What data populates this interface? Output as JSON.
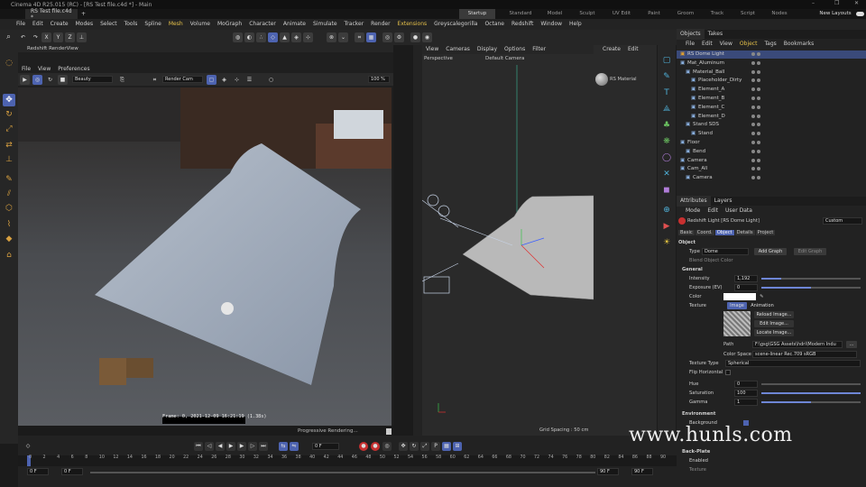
{
  "window": {
    "title": "Cinema 4D R25.015 (RC) - [RS Test file.c4d *] - Main",
    "min": "–",
    "max": "❐",
    "close": "✕"
  },
  "tabs": {
    "doc": "RS Test file.c4d *",
    "add": "+",
    "layouts": [
      "Startup (User)",
      "Standard",
      "Model",
      "Sculpt",
      "UV Edit",
      "Paint",
      "Groom",
      "Track",
      "Script",
      "Nodes"
    ],
    "new_layouts": "New Layouts"
  },
  "menu": [
    "File",
    "Edit",
    "Create",
    "Modes",
    "Select",
    "Tools",
    "Spline",
    "Mesh",
    "Volume",
    "MoGraph",
    "Character",
    "Animate",
    "Simulate",
    "Tracker",
    "Render",
    "Extensions",
    "Greyscalegorilla",
    "Octane",
    "Redshift",
    "Window",
    "Help"
  ],
  "toolbar": {
    "axis": [
      "X",
      "Y",
      "Z"
    ],
    "coord": "⊥"
  },
  "renderview": {
    "title": "Redshift RenderView",
    "menu": [
      "File",
      "View",
      "Preferences"
    ],
    "aov": "Beauty",
    "camera": "Render Cam",
    "zoom": "100 %",
    "stamp": "Frame: 0, 2021-12-09 16:21:19 (1.38s)",
    "status": "Progressive Rendering..."
  },
  "viewport": {
    "menu": [
      "View",
      "Cameras",
      "Display",
      "Options",
      "Filter"
    ],
    "name": "Perspective",
    "camera": "Default Camera",
    "grid": "Grid Spacing : 50 cm"
  },
  "material": {
    "menu": [
      "Create",
      "Edit"
    ],
    "name": "RS Material"
  },
  "objects": {
    "tabs": [
      "Objects",
      "Takes"
    ],
    "menu": [
      "File",
      "Edit",
      "View",
      "Object",
      "Tags",
      "Bookmarks"
    ],
    "rows": [
      {
        "name": "RS Dome Light",
        "indent": 0,
        "sel": true
      },
      {
        "name": "Mat_Aluminum",
        "indent": 0
      },
      {
        "name": "Material_Ball",
        "indent": 1
      },
      {
        "name": "Placeholder_Dirty",
        "indent": 2
      },
      {
        "name": "Element_A",
        "indent": 2
      },
      {
        "name": "Element_B",
        "indent": 2
      },
      {
        "name": "Element_C",
        "indent": 2
      },
      {
        "name": "Element_D",
        "indent": 2
      },
      {
        "name": "Stand SDS",
        "indent": 1
      },
      {
        "name": "Stand",
        "indent": 2
      },
      {
        "name": "Floor",
        "indent": 0
      },
      {
        "name": "Bend",
        "indent": 1
      },
      {
        "name": "Camera",
        "indent": 0
      },
      {
        "name": "Cam_All",
        "indent": 0
      },
      {
        "name": "Camera",
        "indent": 1
      }
    ]
  },
  "attributes": {
    "tabs": [
      "Attributes",
      "Layers"
    ],
    "menu": [
      "Mode",
      "Edit",
      "User Data"
    ],
    "object": "Redshift Light [RS Dome Light]",
    "preset": "Custom",
    "subtabs": [
      "Basic",
      "Coord.",
      "Object",
      "Details",
      "Project"
    ],
    "section_object": "Object",
    "type_label": "Type",
    "type_value": "Dome",
    "add_graph": "Add Graph",
    "edit_graph": "Edit Graph",
    "blend_label": "Blend Object Color",
    "general": "General",
    "intensity_label": "Intensity",
    "intensity": "1,192",
    "intensity_level": 0.2,
    "exposure_label": "Exposure (EV)",
    "exposure": "0",
    "exposure_level": 0.5,
    "color_label": "Color",
    "texture_label": "Texture",
    "image_tab": "Image",
    "animation_tab": "Animation",
    "reload": "Reload Image...",
    "edit_image": "Edit Image...",
    "locate": "Locate Image...",
    "path_label": "Path",
    "path": "F:\\gsg\\GSG Assets\\hdri\\Modern Indu",
    "colorspace_label": "Color Space",
    "colorspace": "scene-linear Rec.709 sRGB",
    "texture_type_label": "Texture Type",
    "texture_type": "Spherical",
    "flip_label": "Flip Horizontal",
    "hue_label": "Hue",
    "hue": "0",
    "hue_level": 0.0,
    "sat_label": "Saturation",
    "sat": "100",
    "sat_level": 1.0,
    "gamma_label": "Gamma",
    "gamma": "1",
    "gamma_level": 0.5,
    "environment": "Environment",
    "background_label": "Background",
    "backplate": "Back-Plate",
    "enabled_label": "Enabled",
    "texture2_label": "Texture"
  },
  "timeline": {
    "frame": "0 F",
    "start": "0 F",
    "start2": "0 F",
    "end": "90 F",
    "end2": "90 F",
    "ticks": [
      "0",
      "2",
      "4",
      "6",
      "8",
      "10",
      "12",
      "14",
      "16",
      "18",
      "20",
      "22",
      "24",
      "26",
      "28",
      "30",
      "32",
      "34",
      "36",
      "38",
      "40",
      "42",
      "44",
      "46",
      "48",
      "50",
      "52",
      "54",
      "56",
      "58",
      "60",
      "62",
      "64",
      "66",
      "68",
      "70",
      "72",
      "74",
      "76",
      "78",
      "80",
      "82",
      "84",
      "86",
      "88",
      "90"
    ]
  },
  "watermark": "www.hunls.com"
}
